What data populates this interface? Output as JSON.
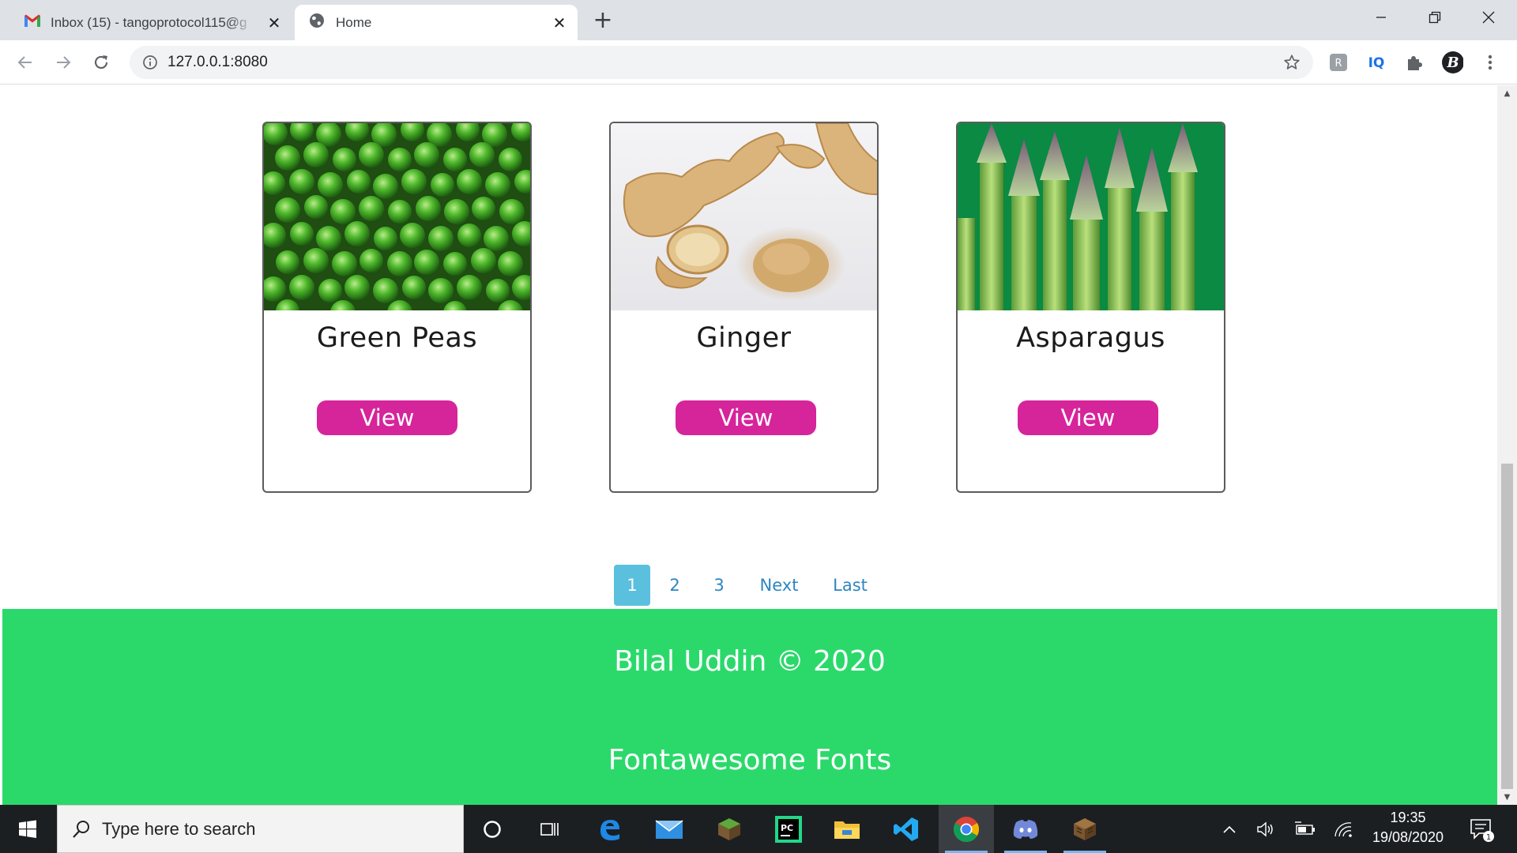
{
  "browser": {
    "tabs": [
      {
        "title": "Inbox (15) - tangoprotocol115@g",
        "icon": "gmail-icon"
      },
      {
        "title": "Home",
        "icon": "globe-icon"
      }
    ],
    "url": "127.0.0.1:8080"
  },
  "products": [
    {
      "name": "Green Peas",
      "button": "View"
    },
    {
      "name": "Ginger",
      "button": "View"
    },
    {
      "name": "Asparagus",
      "button": "View"
    }
  ],
  "pagination": {
    "pages": [
      "1",
      "2",
      "3"
    ],
    "active": "1",
    "next": "Next",
    "last": "Last"
  },
  "footer": {
    "copyright": "Bilal Uddin © 2020",
    "credit": "Fontawesome Fonts"
  },
  "taskbar": {
    "search_placeholder": "Type here to search",
    "time": "19:35",
    "date": "19/08/2020",
    "notification_count": "1"
  },
  "colors": {
    "view_button": "#d6249b",
    "footer_bg": "#2bd96b",
    "active_page": "#5bc0de",
    "page_link": "#2e86c1"
  }
}
